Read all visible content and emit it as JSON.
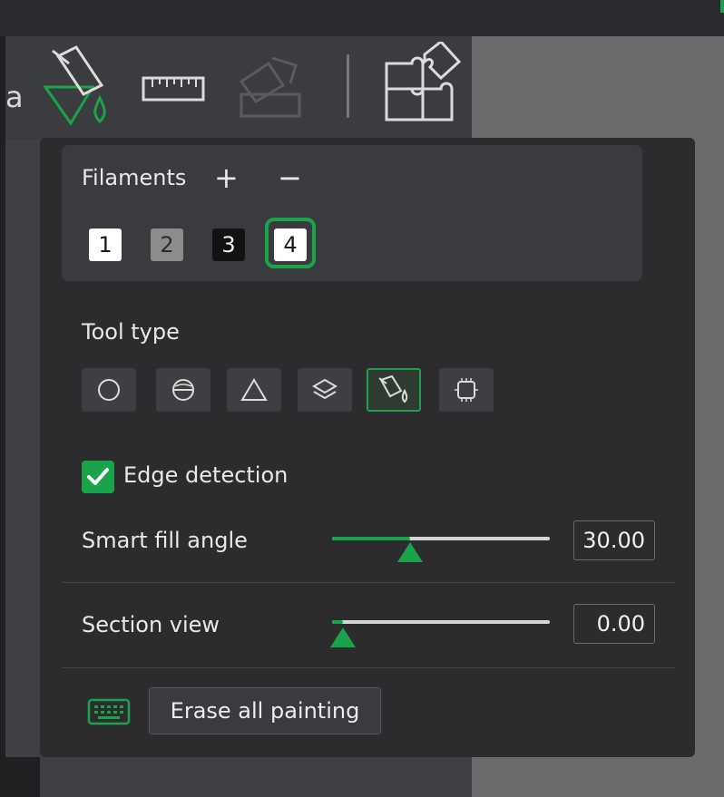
{
  "toolbar": {
    "partial_char": "a",
    "tools": [
      "fill-bucket-icon",
      "ruler-icon",
      "assembly-icon",
      "puzzle-icon"
    ]
  },
  "filaments": {
    "title": "Filaments",
    "add_label": "+",
    "remove_label": "−",
    "swatches": [
      {
        "label": "1",
        "color": "#ffffff",
        "text_color": "#1a1a1a"
      },
      {
        "label": "2",
        "color": "#8c8c8c",
        "text_color": "#2a2a2a"
      },
      {
        "label": "3",
        "color": "#121212",
        "text_color": "#f0f0f0"
      },
      {
        "label": "4",
        "color": "#ffffff",
        "text_color": "#1a1a1a",
        "selected": true
      }
    ]
  },
  "tool_type": {
    "label": "Tool type",
    "tools": [
      "circle-icon",
      "sphere-icon",
      "triangle-icon",
      "layers-icon",
      "fill-bucket-icon",
      "gap-fill-icon"
    ],
    "active": "fill-bucket-icon"
  },
  "edge_detection": {
    "label": "Edge detection",
    "checked": true
  },
  "smart_fill_angle": {
    "label": "Smart fill angle",
    "value": "30.00",
    "fraction": 0.36
  },
  "section_view": {
    "label": "Section view",
    "value": "0.00",
    "fraction": 0.05
  },
  "erase_button": {
    "label": "Erase all painting"
  },
  "colors": {
    "accent": "#1aa34a",
    "panel": "#2c2c2f"
  }
}
